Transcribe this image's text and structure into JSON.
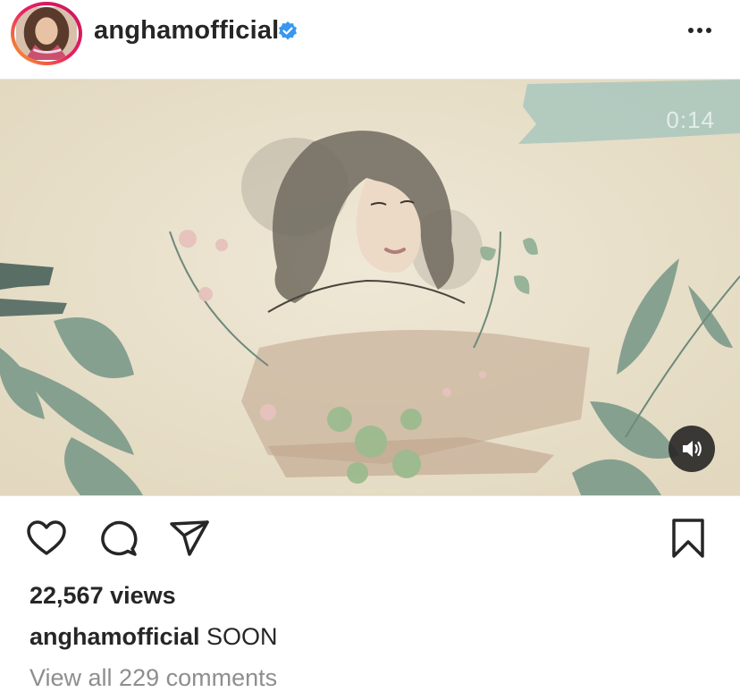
{
  "post": {
    "username": "anghamofficial",
    "verified": true,
    "more_icon": "more-horizontal-icon",
    "video": {
      "timer": "0:14",
      "sound_icon": "speaker-on-icon"
    },
    "actions": {
      "like_icon": "heart-icon",
      "comment_icon": "comment-bubble-icon",
      "share_icon": "paper-plane-icon",
      "save_icon": "bookmark-icon"
    },
    "views": "22,567 views",
    "caption_user": "anghamofficial",
    "caption_text": "SOON",
    "view_comments": "View all 229 comments"
  },
  "colors": {
    "verified_blue": "#3897f0",
    "text_primary": "#262626",
    "text_secondary": "#8e8e8e"
  }
}
